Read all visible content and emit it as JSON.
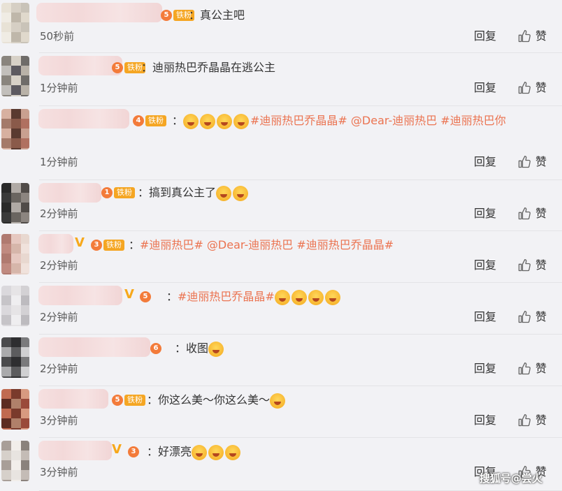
{
  "comments": [
    {
      "badge_level": "5",
      "badge_fan": "铁粉",
      "verified": false,
      "content_parts": [
        {
          "t": "text",
          "v": "："
        },
        {
          "t": "text",
          "v": "真公主吧"
        }
      ],
      "emoji_count": 0,
      "time": "50秒前"
    },
    {
      "badge_level": "5",
      "badge_fan": "铁粉",
      "verified": false,
      "content_parts": [
        {
          "t": "text",
          "v": "："
        },
        {
          "t": "text",
          "v": "迪丽热巴乔晶晶在逃公主"
        }
      ],
      "emoji_count": 0,
      "time": "1分钟前"
    },
    {
      "badge_level": "4",
      "badge_fan": "铁粉",
      "verified": false,
      "content_parts": [
        {
          "t": "text",
          "v": "："
        },
        {
          "t": "topic",
          "v": "#迪丽热巴乔晶晶# @Dear-迪丽热巴 #迪丽热巴你"
        }
      ],
      "emoji_count": 4,
      "emoji_before": true,
      "time": "1分钟前"
    },
    {
      "badge_level": "1",
      "badge_fan": "铁粉",
      "verified": false,
      "content_parts": [
        {
          "t": "text",
          "v": "："
        },
        {
          "t": "text",
          "v": "搞到真公主了"
        }
      ],
      "emoji_count": 2,
      "time": "2分钟前"
    },
    {
      "badge_level": "3",
      "badge_fan": "铁粉",
      "verified": true,
      "content_parts": [
        {
          "t": "text",
          "v": "："
        },
        {
          "t": "topic",
          "v": "#迪丽热巴"
        },
        {
          "t": "topic",
          "v": "# @Dear-迪丽热巴 #迪丽热巴乔晶晶#"
        }
      ],
      "emoji_count": 0,
      "time": "2分钟前"
    },
    {
      "badge_level": "5",
      "badge_fan": "",
      "verified": true,
      "content_parts": [
        {
          "t": "text",
          "v": "："
        },
        {
          "t": "topic",
          "v": "#迪丽热巴乔晶晶#"
        }
      ],
      "emoji_count": 4,
      "time": "2分钟前"
    },
    {
      "badge_level": "6",
      "badge_fan": "",
      "verified": false,
      "content_parts": [
        {
          "t": "text",
          "v": "："
        },
        {
          "t": "text",
          "v": "收图"
        }
      ],
      "emoji_count": 1,
      "time": "2分钟前"
    },
    {
      "badge_level": "5",
      "badge_fan": "铁粉",
      "verified": false,
      "content_parts": [
        {
          "t": "text",
          "v": "："
        },
        {
          "t": "text",
          "v": "你这么美～你这么美～"
        }
      ],
      "emoji_count": 1,
      "time": "3分钟前"
    },
    {
      "badge_level": "3",
      "badge_fan": "",
      "verified": true,
      "content_parts": [
        {
          "t": "text",
          "v": "："
        },
        {
          "t": "text",
          "v": "好漂亮"
        }
      ],
      "emoji_count": 3,
      "time": "3分钟前"
    }
  ],
  "actions": {
    "reply": "回复",
    "like": "赞"
  },
  "watermark": "搜狐号@尝火",
  "colors": {
    "topic": "#eb7350",
    "badge": "#f5a623",
    "level": "#f37b3a",
    "verified": "#f7a81b"
  },
  "icons": {
    "like": "thumbs-up-icon",
    "verified": "verified-v-icon"
  }
}
